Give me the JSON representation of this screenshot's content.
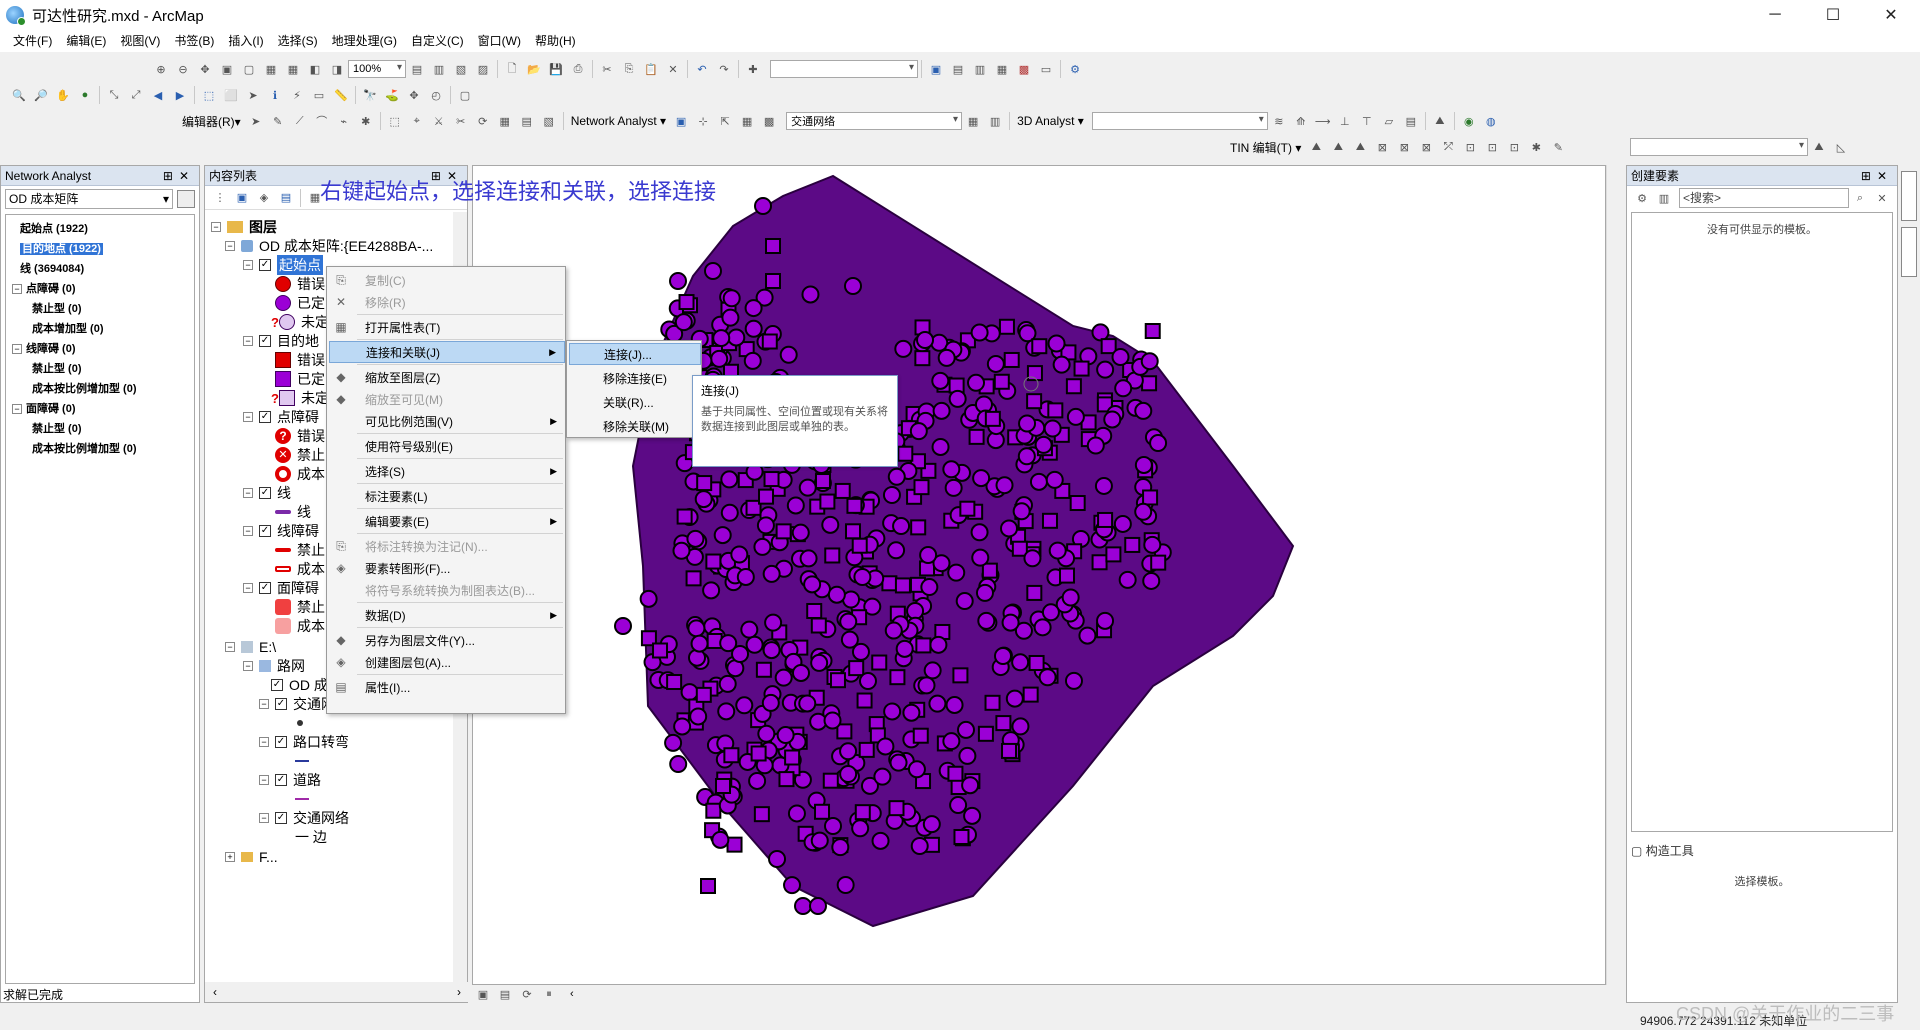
{
  "window": {
    "title": "可达性研究.mxd - ArcMap",
    "minimize": "─",
    "maximize": "☐",
    "close": "✕"
  },
  "menu": [
    "文件(F)",
    "编辑(E)",
    "视图(V)",
    "书签(B)",
    "插入(I)",
    "选择(S)",
    "地理处理(G)",
    "自定义(C)",
    "窗口(W)",
    "帮助(H)"
  ],
  "toolbars": {
    "zoom_value": "100%",
    "editor_label": "编辑器(R)▾",
    "network_analyst_label": "Network Analyst ▾",
    "network_dataset": "交通网络",
    "analyst_3d_label": "3D Analyst ▾",
    "tin_edit_label": "TIN 编辑(T) ▾"
  },
  "network_analyst_panel": {
    "title": "Network Analyst",
    "layer_combo": "OD 成本矩阵",
    "items": [
      {
        "label": "起始点 (1922)",
        "indent": 1,
        "expander": "",
        "selected": false
      },
      {
        "label": "目的地点 (1922)",
        "indent": 1,
        "expander": "",
        "selected": true
      },
      {
        "label": "线 (3694084)",
        "indent": 1,
        "expander": "",
        "selected": false
      },
      {
        "label": "点障碍 (0)",
        "indent": 0,
        "expander": "−",
        "selected": false
      },
      {
        "label": "禁止型 (0)",
        "indent": 2,
        "expander": "",
        "selected": false
      },
      {
        "label": "成本增加型 (0)",
        "indent": 2,
        "expander": "",
        "selected": false
      },
      {
        "label": "线障碍 (0)",
        "indent": 0,
        "expander": "−",
        "selected": false
      },
      {
        "label": "禁止型 (0)",
        "indent": 2,
        "expander": "",
        "selected": false
      },
      {
        "label": "成本按比例增加型 (0)",
        "indent": 2,
        "expander": "",
        "selected": false
      },
      {
        "label": "面障碍 (0)",
        "indent": 0,
        "expander": "−",
        "selected": false
      },
      {
        "label": "禁止型 (0)",
        "indent": 2,
        "expander": "",
        "selected": false
      },
      {
        "label": "成本按比例增加型 (0)",
        "indent": 2,
        "expander": "",
        "selected": false
      }
    ]
  },
  "status_left": "求解已完成",
  "toc": {
    "title": "内容列表",
    "root": "图层",
    "od_group": "OD 成本矩阵:{EE4288BA-...",
    "origins_layer": "起始点",
    "row_labels": [
      "错误",
      "已定",
      "未定",
      "目的地",
      "错误",
      "已定",
      "未定",
      "点障碍",
      "错误",
      "禁止",
      "成本",
      "线",
      "线",
      "线障碍",
      "禁止",
      "成本",
      "面障碍",
      "禁止",
      "成本"
    ],
    "e_drive": "E:\\",
    "road_net": "路网",
    "od_matrix": "OD 成本矩阵",
    "junctions": "交通网络_Junctions",
    "turns": "路口转弯",
    "roads": "道路",
    "network": "交通网络",
    "edges": "一 边",
    "f_item": "F..."
  },
  "annotation": "右键起始点，选择连接和关联，选择连接",
  "context_menu": [
    {
      "label": "复制(C)",
      "disabled": true,
      "icon": "copy-icon",
      "glyph": "⎘"
    },
    {
      "label": "移除(R)",
      "disabled": true,
      "icon": "remove-icon",
      "glyph": "✕"
    },
    {
      "label": "打开属性表(T)",
      "disabled": false,
      "icon": "table-icon",
      "glyph": "▦"
    },
    {
      "label": "连接和关联(J)",
      "disabled": false,
      "icon": "",
      "glyph": "",
      "submenu": true,
      "highlight": true
    },
    {
      "label": "缩放至图层(Z)",
      "disabled": false,
      "icon": "zoom-layer-icon",
      "glyph": "◆"
    },
    {
      "label": "缩放至可见(M)",
      "disabled": true,
      "icon": "zoom-visible-icon",
      "glyph": "◆"
    },
    {
      "label": "可见比例范围(V)",
      "disabled": false,
      "icon": "",
      "glyph": "",
      "submenu": true
    },
    {
      "label": "使用符号级别(E)",
      "disabled": false,
      "icon": "",
      "glyph": ""
    },
    {
      "label": "选择(S)",
      "disabled": false,
      "icon": "",
      "glyph": "",
      "submenu": true
    },
    {
      "label": "标注要素(L)",
      "disabled": false,
      "icon": "",
      "glyph": ""
    },
    {
      "label": "编辑要素(E)",
      "disabled": false,
      "icon": "",
      "glyph": "",
      "submenu": true
    },
    {
      "label": "将标注转换为注记(N)...",
      "disabled": true,
      "icon": "annotation-icon",
      "glyph": "⎘"
    },
    {
      "label": "要素转图形(F)...",
      "disabled": false,
      "icon": "graphics-icon",
      "glyph": "◈"
    },
    {
      "label": "将符号系统转换为制图表达(B)...",
      "disabled": true,
      "icon": "",
      "glyph": ""
    },
    {
      "label": "数据(D)",
      "disabled": false,
      "icon": "",
      "glyph": "",
      "submenu": true
    },
    {
      "label": "另存为图层文件(Y)...",
      "disabled": false,
      "icon": "layer-file-icon",
      "glyph": "◆"
    },
    {
      "label": "创建图层包(A)...",
      "disabled": false,
      "icon": "layer-package-icon",
      "glyph": "◈"
    },
    {
      "label": "属性(I)...",
      "disabled": false,
      "icon": "properties-icon",
      "glyph": "▤"
    }
  ],
  "submenu": [
    "连接(J)...",
    "移除连接(E)",
    "关联(R)...",
    "移除关联(M)"
  ],
  "tooltip": {
    "title": "连接(J)",
    "body": "基于共同属性、空间位置或现有关系将数据连接到此图层或单独的表。"
  },
  "create_features": {
    "title": "创建要素",
    "search_placeholder": "<搜索>",
    "empty_text": "没有可供显示的模板。",
    "construct_tools": "构造工具",
    "select_template": "选择模板。"
  },
  "status": {
    "coords": "94906.772  24391.112 未知单位"
  },
  "watermark": "CSDN @关于作业的二三事",
  "colors": {
    "map_fill": "#5c0a86",
    "point_fill": "#9b00d6",
    "annotation": "#3a3ad0",
    "highlight": "#bcd9f4"
  }
}
